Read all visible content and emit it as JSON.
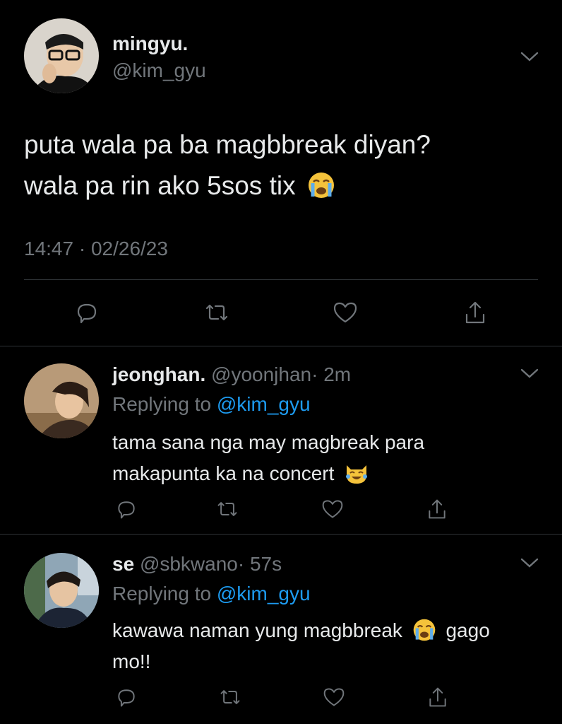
{
  "main_tweet": {
    "display_name": "mingyu.",
    "handle": "@kim_gyu",
    "text_line1": "puta wala pa ba magbbreak diyan?",
    "text_line2": "wala pa rin ako 5sos tix",
    "timestamp": "14:47 · 02/26/23"
  },
  "replies": [
    {
      "display_name": "jeonghan.",
      "handle": "@yoonjhan",
      "time": "· 2m",
      "replying_prefix": "Replying to",
      "replying_to": "@kim_gyu",
      "text_line1": "tama sana nga may magbreak para",
      "text_line2": "makapunta ka na concert"
    },
    {
      "display_name": "se",
      "handle": "@sbkwano",
      "time": "· 57s",
      "replying_prefix": "Replying to",
      "replying_to": "@kim_gyu",
      "text_line1a": "kawawa naman yung magbbreak",
      "text_line1b": "gago",
      "text_line2": "mo!!"
    }
  ],
  "icons": [
    "reply-icon",
    "retweet-icon",
    "like-icon",
    "share-icon",
    "chevron-down-icon",
    "loudly-crying-face-emoji",
    "tears-of-joy-cat-emoji"
  ]
}
